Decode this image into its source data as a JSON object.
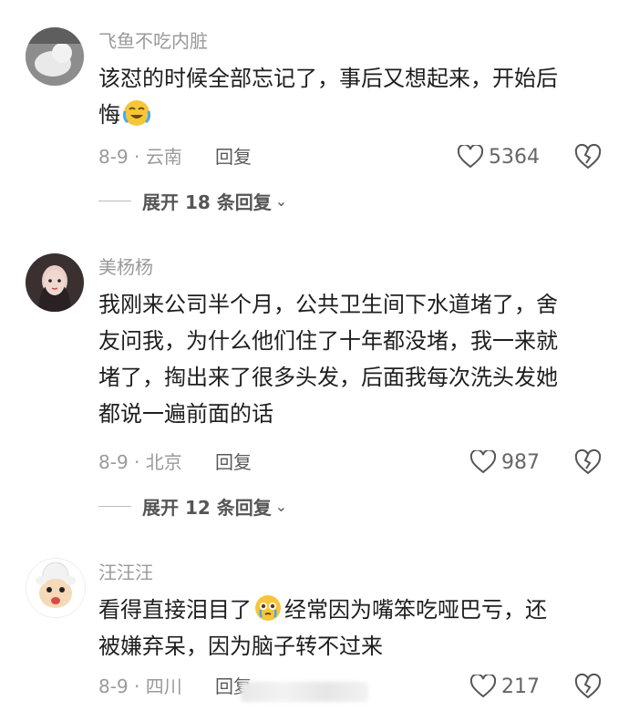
{
  "comments": [
    {
      "username": "飞鱼不吃内脏",
      "text_lines": [
        "该怼的时候全部忘记了，事后又想起来，开始后",
        "悔"
      ],
      "emoji": "crying-laugh-emoji",
      "meta": "8-9 · 云南",
      "reply": "回复",
      "likes": "5364",
      "expand": "展开 18 条回复"
    },
    {
      "username": "美杨杨",
      "text_lines": [
        "我刚来公司半个月，公共卫生间下水道堵了，舍",
        "友问我，为什么他们住了十年都没堵，我一来就",
        "堵了，掏出来了很多头发，后面我每次洗头发她",
        "都说一遍前面的话"
      ],
      "meta": "8-9 · 北京",
      "reply": "回复",
      "likes": "987",
      "expand": "展开 12 条回复"
    },
    {
      "username": "汪汪汪",
      "text_lines": [
        "看得直接泪目了",
        "经常因为嘴笨吃哑巴亏，还",
        "被嫌弃呆，因为脑子转不过来"
      ],
      "emoji": "teary-eyes-emoji",
      "meta": "8-9 · 四川",
      "reply": "回复",
      "likes": "217"
    }
  ],
  "icons": {
    "like": "heart-outline-icon",
    "dislike": "broken-heart-icon",
    "expand": "chevron-down-icon"
  },
  "colors": {
    "text": "#1e1e1e",
    "muted": "#9a9a9a",
    "emoji": "#f7c53a"
  }
}
